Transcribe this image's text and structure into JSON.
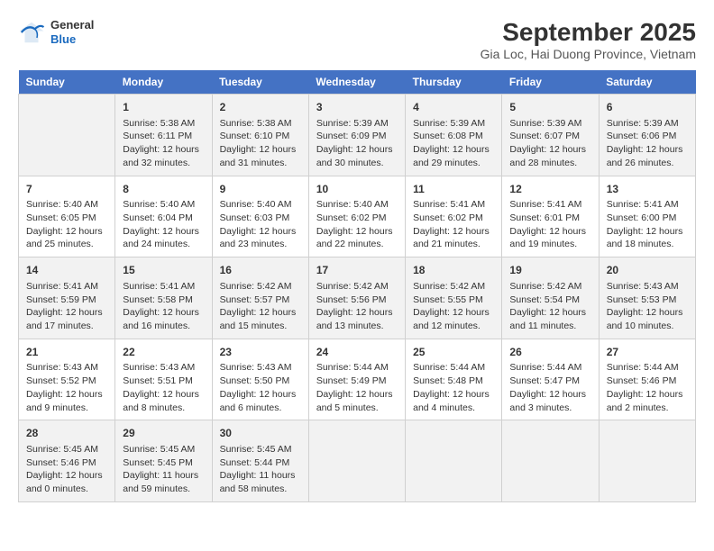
{
  "header": {
    "logo_general": "General",
    "logo_blue": "Blue",
    "title": "September 2025",
    "subtitle": "Gia Loc, Hai Duong Province, Vietnam"
  },
  "days_header": [
    "Sunday",
    "Monday",
    "Tuesday",
    "Wednesday",
    "Thursday",
    "Friday",
    "Saturday"
  ],
  "weeks": [
    [
      {
        "day": "",
        "content": ""
      },
      {
        "day": "1",
        "content": "Sunrise: 5:38 AM\nSunset: 6:11 PM\nDaylight: 12 hours\nand 32 minutes."
      },
      {
        "day": "2",
        "content": "Sunrise: 5:38 AM\nSunset: 6:10 PM\nDaylight: 12 hours\nand 31 minutes."
      },
      {
        "day": "3",
        "content": "Sunrise: 5:39 AM\nSunset: 6:09 PM\nDaylight: 12 hours\nand 30 minutes."
      },
      {
        "day": "4",
        "content": "Sunrise: 5:39 AM\nSunset: 6:08 PM\nDaylight: 12 hours\nand 29 minutes."
      },
      {
        "day": "5",
        "content": "Sunrise: 5:39 AM\nSunset: 6:07 PM\nDaylight: 12 hours\nand 28 minutes."
      },
      {
        "day": "6",
        "content": "Sunrise: 5:39 AM\nSunset: 6:06 PM\nDaylight: 12 hours\nand 26 minutes."
      }
    ],
    [
      {
        "day": "7",
        "content": "Sunrise: 5:40 AM\nSunset: 6:05 PM\nDaylight: 12 hours\nand 25 minutes."
      },
      {
        "day": "8",
        "content": "Sunrise: 5:40 AM\nSunset: 6:04 PM\nDaylight: 12 hours\nand 24 minutes."
      },
      {
        "day": "9",
        "content": "Sunrise: 5:40 AM\nSunset: 6:03 PM\nDaylight: 12 hours\nand 23 minutes."
      },
      {
        "day": "10",
        "content": "Sunrise: 5:40 AM\nSunset: 6:02 PM\nDaylight: 12 hours\nand 22 minutes."
      },
      {
        "day": "11",
        "content": "Sunrise: 5:41 AM\nSunset: 6:02 PM\nDaylight: 12 hours\nand 21 minutes."
      },
      {
        "day": "12",
        "content": "Sunrise: 5:41 AM\nSunset: 6:01 PM\nDaylight: 12 hours\nand 19 minutes."
      },
      {
        "day": "13",
        "content": "Sunrise: 5:41 AM\nSunset: 6:00 PM\nDaylight: 12 hours\nand 18 minutes."
      }
    ],
    [
      {
        "day": "14",
        "content": "Sunrise: 5:41 AM\nSunset: 5:59 PM\nDaylight: 12 hours\nand 17 minutes."
      },
      {
        "day": "15",
        "content": "Sunrise: 5:41 AM\nSunset: 5:58 PM\nDaylight: 12 hours\nand 16 minutes."
      },
      {
        "day": "16",
        "content": "Sunrise: 5:42 AM\nSunset: 5:57 PM\nDaylight: 12 hours\nand 15 minutes."
      },
      {
        "day": "17",
        "content": "Sunrise: 5:42 AM\nSunset: 5:56 PM\nDaylight: 12 hours\nand 13 minutes."
      },
      {
        "day": "18",
        "content": "Sunrise: 5:42 AM\nSunset: 5:55 PM\nDaylight: 12 hours\nand 12 minutes."
      },
      {
        "day": "19",
        "content": "Sunrise: 5:42 AM\nSunset: 5:54 PM\nDaylight: 12 hours\nand 11 minutes."
      },
      {
        "day": "20",
        "content": "Sunrise: 5:43 AM\nSunset: 5:53 PM\nDaylight: 12 hours\nand 10 minutes."
      }
    ],
    [
      {
        "day": "21",
        "content": "Sunrise: 5:43 AM\nSunset: 5:52 PM\nDaylight: 12 hours\nand 9 minutes."
      },
      {
        "day": "22",
        "content": "Sunrise: 5:43 AM\nSunset: 5:51 PM\nDaylight: 12 hours\nand 8 minutes."
      },
      {
        "day": "23",
        "content": "Sunrise: 5:43 AM\nSunset: 5:50 PM\nDaylight: 12 hours\nand 6 minutes."
      },
      {
        "day": "24",
        "content": "Sunrise: 5:44 AM\nSunset: 5:49 PM\nDaylight: 12 hours\nand 5 minutes."
      },
      {
        "day": "25",
        "content": "Sunrise: 5:44 AM\nSunset: 5:48 PM\nDaylight: 12 hours\nand 4 minutes."
      },
      {
        "day": "26",
        "content": "Sunrise: 5:44 AM\nSunset: 5:47 PM\nDaylight: 12 hours\nand 3 minutes."
      },
      {
        "day": "27",
        "content": "Sunrise: 5:44 AM\nSunset: 5:46 PM\nDaylight: 12 hours\nand 2 minutes."
      }
    ],
    [
      {
        "day": "28",
        "content": "Sunrise: 5:45 AM\nSunset: 5:46 PM\nDaylight: 12 hours\nand 0 minutes."
      },
      {
        "day": "29",
        "content": "Sunrise: 5:45 AM\nSunset: 5:45 PM\nDaylight: 11 hours\nand 59 minutes."
      },
      {
        "day": "30",
        "content": "Sunrise: 5:45 AM\nSunset: 5:44 PM\nDaylight: 11 hours\nand 58 minutes."
      },
      {
        "day": "",
        "content": ""
      },
      {
        "day": "",
        "content": ""
      },
      {
        "day": "",
        "content": ""
      },
      {
        "day": "",
        "content": ""
      }
    ]
  ]
}
